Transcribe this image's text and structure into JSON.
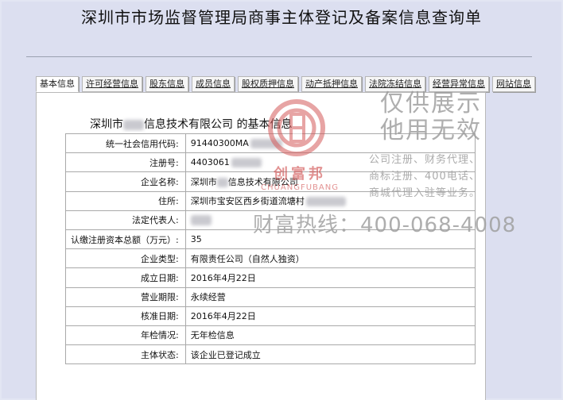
{
  "page_title": "深圳市市场监督管理局商事主体登记及备案信息查询单",
  "tabs": [
    {
      "label": "基本信息",
      "active": true
    },
    {
      "label": "许可经营信息",
      "active": false
    },
    {
      "label": "股东信息",
      "active": false
    },
    {
      "label": "成员信息",
      "active": false
    },
    {
      "label": "股权质押信息",
      "active": false
    },
    {
      "label": "动产抵押信息",
      "active": false
    },
    {
      "label": "法院冻结信息",
      "active": false
    },
    {
      "label": "经营异常信息",
      "active": false
    },
    {
      "label": "网站信息",
      "active": false
    }
  ],
  "caption": {
    "prefix": "深圳市",
    "suffix": "信息技术有限公司",
    "tail": " 的基本信息"
  },
  "rows": [
    {
      "key": "统一社会信用代码:",
      "value": "91440300MA"
    },
    {
      "key": "注册号:",
      "value": "4403061"
    },
    {
      "key": "企业名称:",
      "value": "深圳市",
      "value2": "信息技术有限公司"
    },
    {
      "key": "住所:",
      "value": "深圳市宝安区西乡街道流塘村"
    },
    {
      "key": "法定代表人:",
      "value": ""
    },
    {
      "key": "认缴注册资本总额（万元）:",
      "value": "35"
    },
    {
      "key": "企业类型:",
      "value": "有限责任公司（自然人独资）"
    },
    {
      "key": "成立日期:",
      "value": "2016年4月22日"
    },
    {
      "key": "营业期限:",
      "value": "永续经营"
    },
    {
      "key": "核准日期:",
      "value": "2016年4月22日"
    },
    {
      "key": "年检情况:",
      "value": "无年检信息"
    },
    {
      "key": "主体状态:",
      "value": "该企业已登记成立"
    }
  ],
  "watermark": {
    "brand_cn": "创富邦",
    "brand_en": "CHUANGFUBANG",
    "line1": "仅供展示",
    "line2": "他用无效",
    "services": [
      "公司注册、财务代理、",
      "商标注册、400电话、",
      "商城代理入驻等业务。"
    ],
    "hotline": "财富热线：400-068-4008",
    "colors": {
      "brand": "#d04a4a",
      "gray": "#a0a0a0"
    }
  }
}
